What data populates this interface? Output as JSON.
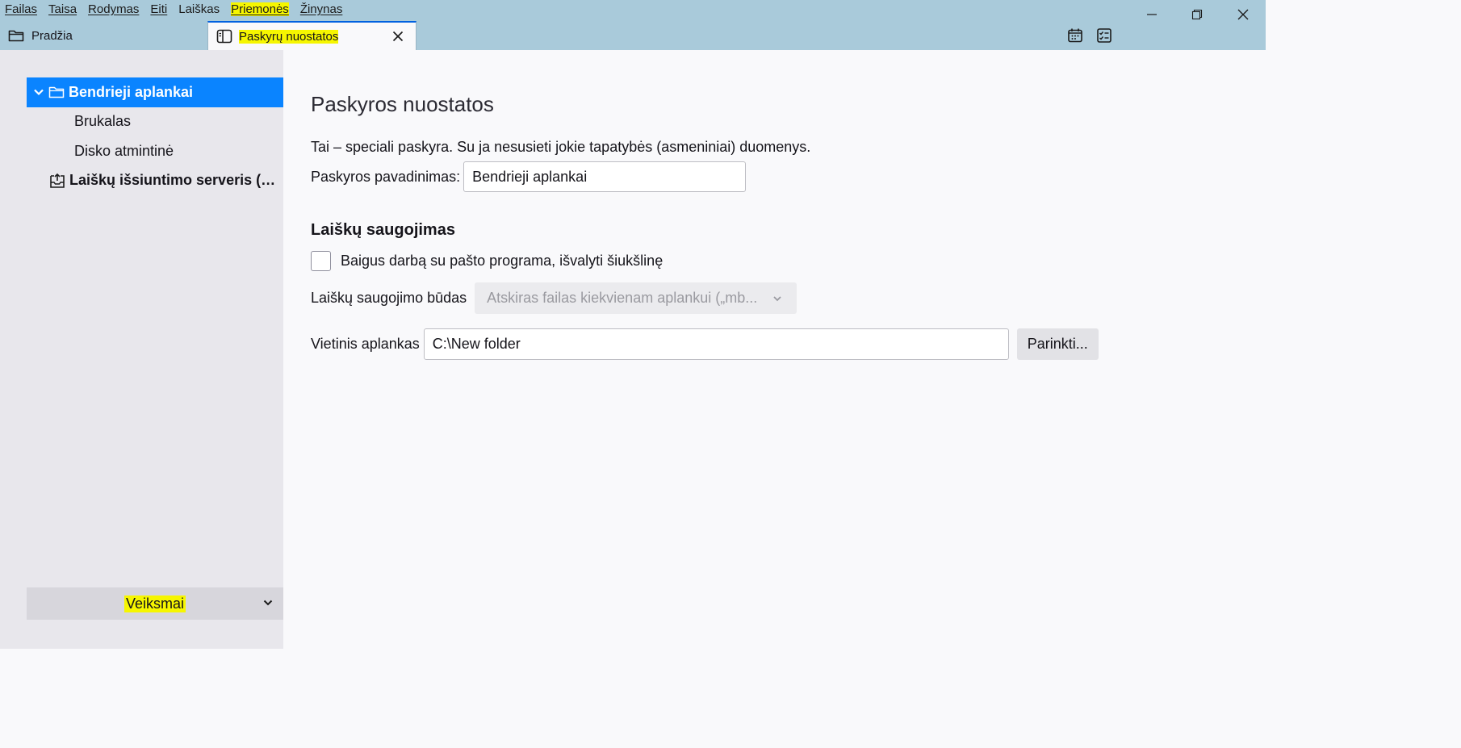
{
  "menubar": {
    "items": [
      {
        "label": "Failas"
      },
      {
        "label": "Taisa"
      },
      {
        "label": "Rodymas"
      },
      {
        "label": "Eiti"
      },
      {
        "label": "Laiškas"
      },
      {
        "label": "Priemonės"
      },
      {
        "label": "Žinynas"
      }
    ]
  },
  "tabs": {
    "home": {
      "label": "Pradžia"
    },
    "active": {
      "label": "Paskyrų nuostatos"
    }
  },
  "sidebar": {
    "tree": [
      {
        "label": "Bendrieji aplankai"
      },
      {
        "label": "Brukalas"
      },
      {
        "label": "Disko atmintinė"
      },
      {
        "label": "Laiškų išsiuntimo serveris (SMTP)"
      }
    ],
    "actions_label": "Veiksmai"
  },
  "main": {
    "heading": "Paskyros nuostatos",
    "intro": "Tai – speciali paskyra. Su ja nesusieti jokie tapatybės (asmeniniai) duomenys.",
    "account_name": {
      "label": "Paskyros pavadinimas:",
      "value": "Bendrieji aplankai"
    },
    "storage": {
      "title": "Laiškų saugojimas",
      "empty_trash_label": "Baigus darbą su pašto programa, išvalyti šiukšlinę",
      "store_type_label": "Laiškų saugojimo būdas",
      "store_type_value": "Atskiras failas kiekvienam aplankui („mb...",
      "local_dir_label": "Vietinis aplankas",
      "local_dir_value": "C:\\New folder",
      "browse_label": "Parinkti..."
    }
  },
  "colors": {
    "chrome": "#a9cada",
    "accent": "#0a84ff",
    "highlight": "#f6f600",
    "sidebar": "#e8e7ec"
  }
}
